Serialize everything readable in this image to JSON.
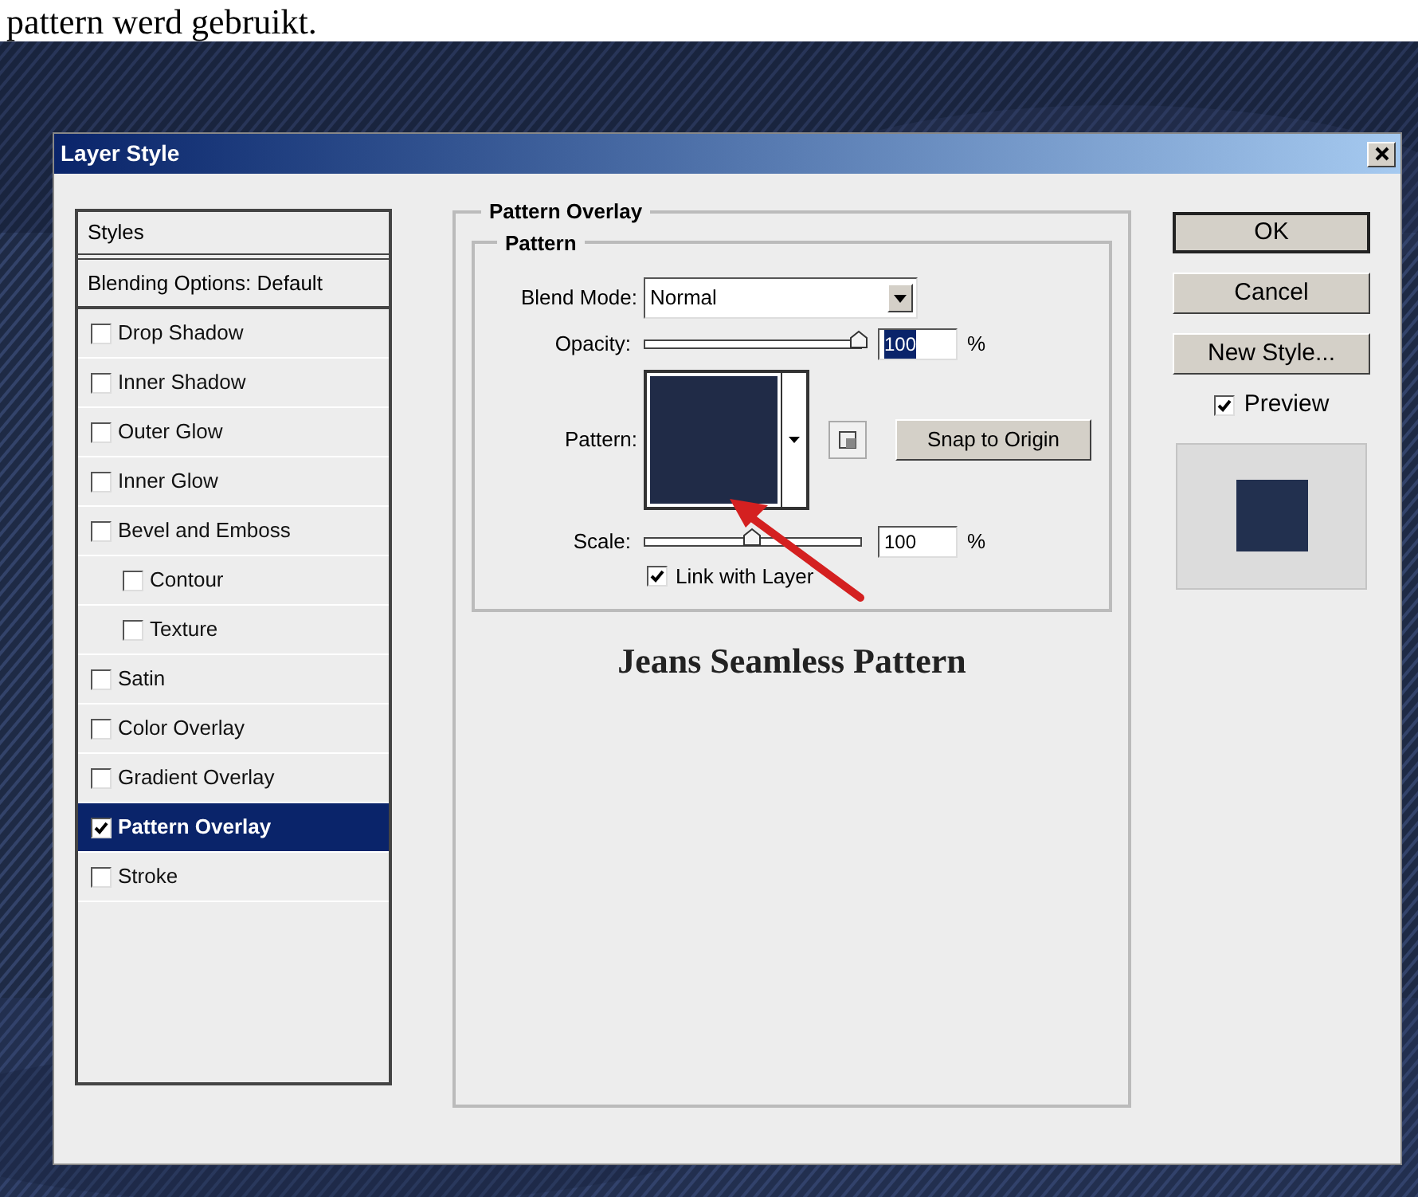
{
  "caption": "pattern werd gebruikt.",
  "dialog": {
    "title": "Layer Style",
    "styles_list": {
      "header": "Styles",
      "blending": "Blending Options: Default",
      "items": [
        {
          "label": "Drop Shadow",
          "checked": false,
          "selected": false
        },
        {
          "label": "Inner Shadow",
          "checked": false,
          "selected": false
        },
        {
          "label": "Outer Glow",
          "checked": false,
          "selected": false
        },
        {
          "label": "Inner Glow",
          "checked": false,
          "selected": false
        },
        {
          "label": "Bevel and Emboss",
          "checked": false,
          "selected": false,
          "children": [
            {
              "label": "Contour",
              "checked": false,
              "selected": false
            },
            {
              "label": "Texture",
              "checked": false,
              "selected": false
            }
          ]
        },
        {
          "label": "Satin",
          "checked": false,
          "selected": false
        },
        {
          "label": "Color Overlay",
          "checked": false,
          "selected": false
        },
        {
          "label": "Gradient Overlay",
          "checked": false,
          "selected": false
        },
        {
          "label": "Pattern Overlay",
          "checked": true,
          "selected": true
        },
        {
          "label": "Stroke",
          "checked": false,
          "selected": false
        }
      ]
    },
    "section": {
      "title": "Pattern Overlay",
      "group": "Pattern",
      "blend_mode": {
        "label": "Blend Mode:",
        "value": "Normal"
      },
      "opacity": {
        "label": "Opacity:",
        "level": 1,
        "value": "100",
        "unit": "%",
        "text_selected": true
      },
      "pattern": {
        "label": "Pattern:",
        "button": "Snap to Origin"
      },
      "scale": {
        "label": "Scale:",
        "level": 0.5,
        "value": "100",
        "unit": "%",
        "text_selected": false
      },
      "link_with_layer": {
        "label": "Link with Layer",
        "checked": true
      },
      "caption": "Jeans Seamless Pattern"
    },
    "buttons": [
      {
        "label": "OK",
        "default": true
      },
      {
        "label": "Cancel",
        "default": false
      },
      {
        "label": "New Style...",
        "default": false
      }
    ],
    "preview": {
      "label": "Preview",
      "checked": true
    }
  }
}
